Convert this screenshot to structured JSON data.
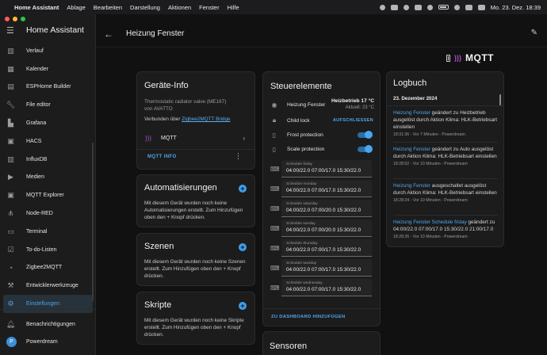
{
  "menubar": {
    "app_name": "Home Assistant",
    "items": [
      "Ablage",
      "Bearbeiten",
      "Darstellung",
      "Aktionen",
      "Fenster",
      "Hilfe"
    ],
    "datetime": "Mo. 23. Dez.  18:39"
  },
  "window": {
    "traffic_colors": [
      "#ff5f57",
      "#febc2e",
      "#28c840"
    ]
  },
  "sidebar": {
    "title": "Home Assistant",
    "items": [
      {
        "label": "Verlauf",
        "icon": "chart-icon"
      },
      {
        "label": "Kalender",
        "icon": "calendar-icon"
      },
      {
        "label": "ESPHome Builder",
        "icon": "esphome-icon"
      },
      {
        "label": "File editor",
        "icon": "wrench-icon"
      },
      {
        "label": "Grafana",
        "icon": "grafana-icon"
      },
      {
        "label": "HACS",
        "icon": "hacs-icon"
      },
      {
        "label": "InfluxDB",
        "icon": "influxdb-icon"
      },
      {
        "label": "Medien",
        "icon": "media-icon"
      },
      {
        "label": "MQTT Explorer",
        "icon": "mqtt-explorer-icon"
      },
      {
        "label": "Node-RED",
        "icon": "node-red-icon"
      },
      {
        "label": "Terminal",
        "icon": "terminal-icon"
      },
      {
        "label": "To-do-Listen",
        "icon": "todo-icon"
      },
      {
        "label": "Zigbee2MQTT",
        "icon": "zigbee-icon"
      },
      {
        "label": "Entwicklerwerkzeuge",
        "icon": "hammer-icon"
      },
      {
        "label": "Einstellungen",
        "icon": "gear-icon"
      }
    ],
    "notifications_label": "Benachrichtigungen",
    "user_label": "Powerdream",
    "user_initial": "P",
    "active_color": "#4aa3e8"
  },
  "topbar": {
    "title": "Heizung Fenster"
  },
  "logo": {
    "text": "MQTT"
  },
  "device_info": {
    "title": "Geräte-Info",
    "model": "Thermostatic radiator valve (ME167)",
    "vendor": "von AVATTO",
    "via_prefix": "Verbunden über ",
    "via_link": "Zigbee2MQTT Bridge",
    "integration_label": "MQTT",
    "info_button": "MQTT INFO"
  },
  "automations": {
    "title": "Automatisierungen",
    "text": "Mit diesem Gerät wurden noch keine Automatisierungen erstellt. Zum Hinzufügen oben den + Knopf drücken."
  },
  "scenes": {
    "title": "Szenen",
    "text": "Mit diesem Gerät wurden noch keine Szenen erstellt. Zum Hinzufügen oben den + Knopf drücken."
  },
  "scripts": {
    "title": "Skripte",
    "text": "Mit diesem Gerät wurden noch keine Skripte erstellt. Zum Hinzufügen oben den + Knopf drücken."
  },
  "controls": {
    "title": "Steuerelemente",
    "climate_name": "Heizung Fenster",
    "climate_state": "Heizbetrieb 17 °C",
    "climate_current": "Aktuell: 23 °C",
    "child_lock_name": "Child lock",
    "child_lock_action": "AUFSCHLIESSEN",
    "frost_name": "Frost protection",
    "frost_on": true,
    "scale_name": "Scale protection",
    "scale_on": true,
    "schedules": [
      {
        "label": "Schedule friday",
        "value": "04:00/22.0 07:00/17.0 15:30/22.0"
      },
      {
        "label": "Schedule monday",
        "value": "04:00/22.0 07:00/17.0 15:30/22.0"
      },
      {
        "label": "Schedule saturday",
        "value": "04:00/22.0 07:00/20.0 15:30/22.0"
      },
      {
        "label": "Schedule sunday",
        "value": "04:00/22.0 07:00/20.0 15:30/22.0"
      },
      {
        "label": "Schedule thursday",
        "value": "04:00/22.0 07:00/17.0 15:30/22.0"
      },
      {
        "label": "Schedule tuesday",
        "value": "04:00/22.0 07:00/17.0 15:30/22.0"
      },
      {
        "label": "Schedule wednesday",
        "value": "04:00/22.0 07:00/17.0 15:30/22.0"
      }
    ],
    "add_link": "ZU DASHBOARD HINZUFÜGEN"
  },
  "sensors": {
    "title": "Sensoren"
  },
  "logbook": {
    "title": "Logbuch",
    "date": "23. Dezember 2024",
    "entries": [
      {
        "entity": "Heizung Fenster",
        "text": " geändert zu Heizbetrieb ausgelöst durch Aktion Klima: HLK-Betriebsart einstellen",
        "meta": "18:31:36 - Vor 7 Minuten - Powerdream"
      },
      {
        "entity": "Heizung Fenster",
        "text": " geändert zu Auto ausgelöst durch Aktion Klima: HLK-Betriebsart einstellen",
        "meta": "18:28:52 - Vor 10 Minuten - Powerdream"
      },
      {
        "entity": "Heizung Fenster",
        "text": " ausgeschaltet ausgelöst durch Aktion Klima: HLK-Betriebsart einstellen",
        "meta": "18:28:34 - Vor 10 Minuten - Powerdream"
      },
      {
        "entity": "Heizung Fenster Schedule friday",
        "text": " geändert zu 04:00/22.0 07:00/17.0 15:30/22.0 21:00/17.0",
        "meta": "18:28:26 - Vor 10 Minuten - Powerdream"
      }
    ]
  }
}
